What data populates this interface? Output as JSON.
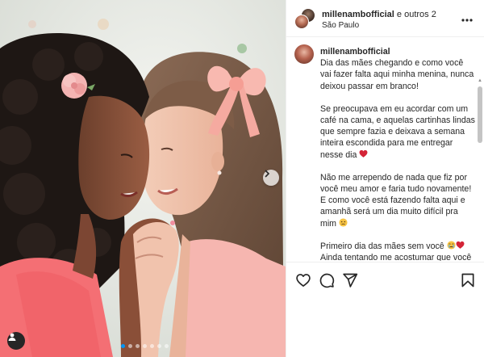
{
  "post": {
    "author": "millenambofficial",
    "coauthors": "e outros 2",
    "location": "São Paulo",
    "caption_username": "millenambofficial",
    "caption": [
      "Dia das mães chegando e como você vai fazer falta aqui minha menina, nunca deixou passar em branco!",
      "Se preocupava em eu acordar com um café na cama, e aquelas cartinhas lindas que sempre fazia e deixava a semana inteira escondida para me entregar nesse dia",
      "Não me arrependo de nada que fiz por você meu amor e faria tudo novamente! E como você está fazendo falta aqui e amanhã será um dia muito difícil pra mim",
      "Primeiro dia das mães sem você",
      "Ainda tentando me acostumar que você não volta mais."
    ]
  },
  "icons": {
    "more": "more-horizontal-icon",
    "like": "heart-icon",
    "comment": "comment-icon",
    "share": "paper-plane-icon",
    "save": "bookmark-icon",
    "next": "chevron-right-icon",
    "tag": "user-tag-icon",
    "heart_emoji": "red-heart-emoji",
    "sad_emoji": "sad-face-emoji",
    "crying_emoji": "crying-face-emoji"
  },
  "carousel": {
    "count": 7,
    "active_index": 0
  },
  "colors": {
    "accent": "#0095f6",
    "text": "#262626",
    "border": "#efefef",
    "heart": "#e0245e"
  }
}
